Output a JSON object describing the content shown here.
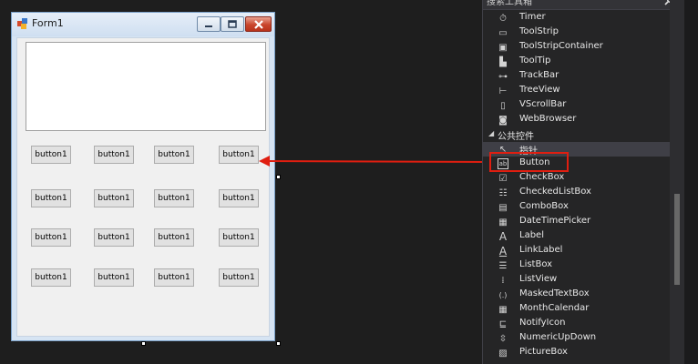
{
  "form": {
    "title": "Form1",
    "buttons": [
      [
        "button1",
        "button1",
        "button1",
        "button1"
      ],
      [
        "button1",
        "button1",
        "button1",
        "button1"
      ],
      [
        "button1",
        "button1",
        "button1",
        "button1"
      ],
      [
        "button1",
        "button1",
        "button1",
        "button1"
      ]
    ]
  },
  "toolbox": {
    "search_placeholder": "搜索工具箱",
    "items_top": [
      {
        "label": "Timer",
        "icon": "stopwatch-icon",
        "glyph": "⏱"
      },
      {
        "label": "ToolStrip",
        "icon": "toolstrip-icon",
        "glyph": "▭"
      },
      {
        "label": "ToolStripContainer",
        "icon": "toolstripcontainer-icon",
        "glyph": "▣"
      },
      {
        "label": "ToolTip",
        "icon": "tooltip-icon",
        "glyph": "▙"
      },
      {
        "label": "TrackBar",
        "icon": "trackbar-icon",
        "glyph": "⊶"
      },
      {
        "label": "TreeView",
        "icon": "treeview-icon",
        "glyph": "⊢"
      },
      {
        "label": "VScrollBar",
        "icon": "vscrollbar-icon",
        "glyph": "▯"
      },
      {
        "label": "WebBrowser",
        "icon": "webbrowser-icon",
        "glyph": "◙"
      }
    ],
    "group_label": "公共控件",
    "items_common": [
      {
        "label": "指针",
        "icon": "pointer-icon",
        "glyph": "↖"
      },
      {
        "label": "Button",
        "icon": "button-icon",
        "glyph": "ab"
      },
      {
        "label": "CheckBox",
        "icon": "checkbox-icon",
        "glyph": "☑"
      },
      {
        "label": "CheckedListBox",
        "icon": "checkedlistbox-icon",
        "glyph": "☷"
      },
      {
        "label": "ComboBox",
        "icon": "combobox-icon",
        "glyph": "▤"
      },
      {
        "label": "DateTimePicker",
        "icon": "datetimepicker-icon",
        "glyph": "▦"
      },
      {
        "label": "Label",
        "icon": "label-icon",
        "glyph": "A"
      },
      {
        "label": "LinkLabel",
        "icon": "linklabel-icon",
        "glyph": "A"
      },
      {
        "label": "ListBox",
        "icon": "listbox-icon",
        "glyph": "☰"
      },
      {
        "label": "ListView",
        "icon": "listview-icon",
        "glyph": "⁞"
      },
      {
        "label": "MaskedTextBox",
        "icon": "maskedtextbox-icon",
        "glyph": "(.)"
      },
      {
        "label": "MonthCalendar",
        "icon": "monthcalendar-icon",
        "glyph": "▦"
      },
      {
        "label": "NotifyIcon",
        "icon": "notifyicon-icon",
        "glyph": "⊑"
      },
      {
        "label": "NumericUpDown",
        "icon": "numericupdown-icon",
        "glyph": "⇳"
      },
      {
        "label": "PictureBox",
        "icon": "picturebox-icon",
        "glyph": "▨"
      }
    ]
  },
  "colors": {
    "annotation_red": "#e01e10",
    "dark_bg": "#1e1e1e",
    "panel_bg": "#252526"
  }
}
